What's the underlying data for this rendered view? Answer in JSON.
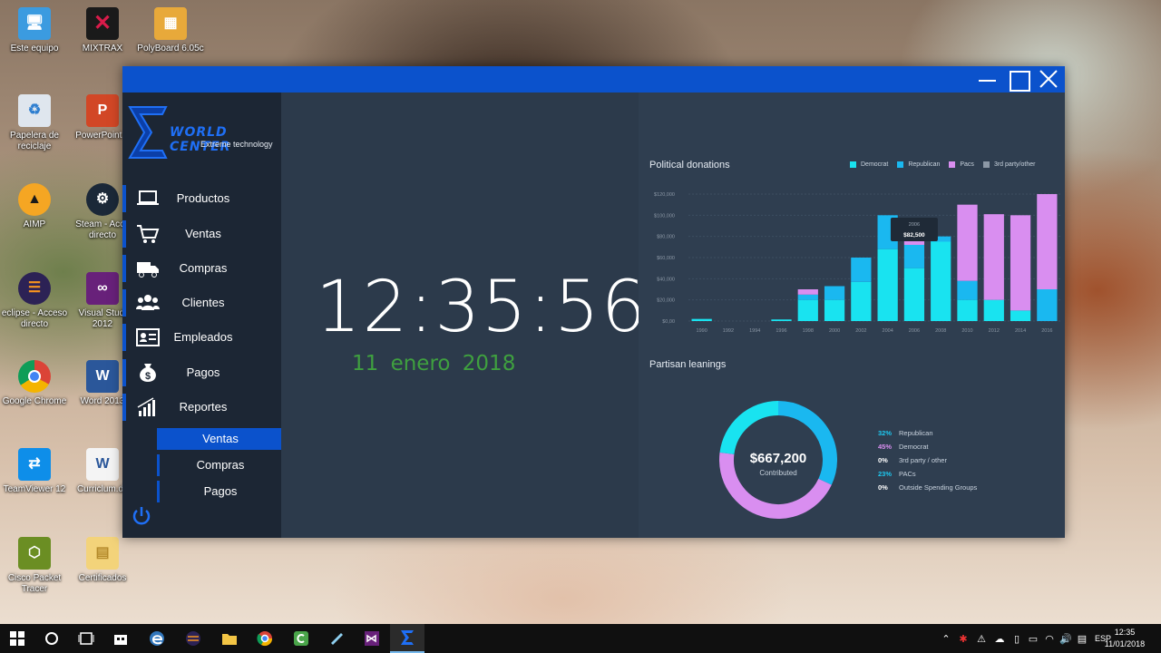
{
  "desktop": {
    "icons": [
      {
        "label": "Este equipo",
        "glyph": "this-pc-icon"
      },
      {
        "label": "MIXTRAX",
        "glyph": "mixtrax-icon"
      },
      {
        "label": "PolyBoard 6.05c",
        "glyph": "polyboard-icon"
      },
      {
        "label": "Papelera de reciclaje",
        "glyph": "recycle-bin-icon"
      },
      {
        "label": "PowerPoint 2",
        "glyph": "powerpoint-icon"
      },
      {
        "label": "AIMP",
        "glyph": "aimp-icon"
      },
      {
        "label": "Steam - Acce directo",
        "glyph": "steam-icon"
      },
      {
        "label": "eclipse - Acceso directo",
        "glyph": "eclipse-icon"
      },
      {
        "label": "Visual Studi 2012",
        "glyph": "visual-studio-icon"
      },
      {
        "label": "Google Chrome",
        "glyph": "chrome-icon"
      },
      {
        "label": "Word 2013",
        "glyph": "word-icon"
      },
      {
        "label": "TeamViewer 12",
        "glyph": "teamviewer-icon"
      },
      {
        "label": "Curriclum.dc",
        "glyph": "word-document-icon"
      },
      {
        "label": "Cisco Packet Tracer",
        "glyph": "cisco-packet-tracer-icon"
      },
      {
        "label": "Certificados",
        "glyph": "folder-icon"
      }
    ]
  },
  "app": {
    "logo": {
      "brand": "World Center",
      "tagline": "Extreme technology"
    },
    "menu": [
      {
        "label": "Productos",
        "icon": "laptop-icon"
      },
      {
        "label": "Ventas",
        "icon": "cart-icon"
      },
      {
        "label": "Compras",
        "icon": "truck-icon"
      },
      {
        "label": "Clientes",
        "icon": "users-icon"
      },
      {
        "label": "Empleados",
        "icon": "id-card-icon"
      },
      {
        "label": "Pagos",
        "icon": "money-bag-icon"
      },
      {
        "label": "Reportes",
        "icon": "bar-chart-icon"
      }
    ],
    "submenu": [
      {
        "label": "Ventas",
        "active": true
      },
      {
        "label": "Compras",
        "active": false
      },
      {
        "label": "Pagos",
        "active": false
      }
    ],
    "clock": {
      "time": "12:35:56",
      "date": "11 enero 2018"
    },
    "accent": "#0b52cc"
  },
  "dashboard": {
    "donations_title": "Political donations",
    "partisan_title": "Partisan leanings",
    "donut_value": "$667,200",
    "donut_label": "Contributed",
    "tooltip": {
      "year": "2006",
      "value": "$82,500"
    },
    "partisan": [
      {
        "pct": "32%",
        "label": "Republican",
        "color": "#1ec8f0"
      },
      {
        "pct": "45%",
        "label": "Democrat",
        "color": "#d98ef0"
      },
      {
        "pct": "0%",
        "label": "3rd party / other",
        "color": "#ffffff"
      },
      {
        "pct": "23%",
        "label": "PACs",
        "color": "#1ec8f0"
      },
      {
        "pct": "0%",
        "label": "Outside Spending Groups",
        "color": "#ffffff"
      }
    ]
  },
  "chart_data": [
    {
      "type": "bar",
      "stacked": true,
      "title": "Political donations",
      "categories": [
        "1990",
        "1992",
        "1994",
        "1996",
        "1998",
        "2000",
        "2002",
        "2004",
        "2006",
        "2008",
        "2010",
        "2012",
        "2014",
        "2016"
      ],
      "series": [
        {
          "name": "Democrat",
          "color": "#19e3f0",
          "values": [
            2000,
            0,
            0,
            1500,
            20000,
            20000,
            37000,
            68000,
            50000,
            75000,
            20000,
            20000,
            10000,
            0
          ]
        },
        {
          "name": "Republican",
          "color": "#1ab8f0",
          "values": [
            0,
            0,
            0,
            0,
            5000,
            13000,
            23000,
            32000,
            22000,
            5000,
            18000,
            0,
            0,
            30000
          ]
        },
        {
          "name": "Pacs",
          "color": "#d98ef0",
          "values": [
            0,
            0,
            0,
            0,
            5000,
            0,
            0,
            0,
            10000,
            0,
            72000,
            81000,
            90000,
            90000
          ]
        },
        {
          "name": "3rd party/other",
          "color": "#8c98a6",
          "values": [
            0,
            0,
            0,
            0,
            0,
            0,
            0,
            0,
            0,
            0,
            0,
            0,
            0,
            0
          ]
        }
      ],
      "y_ticks": [
        "$0,00",
        "$20,000",
        "$40,000",
        "$60,000",
        "$80,000",
        "$100,000",
        "$120,000"
      ],
      "ylim": [
        0,
        120000
      ],
      "legend": "top-right"
    },
    {
      "type": "pie",
      "title": "Partisan leanings",
      "categories": [
        "Republican",
        "Democrat",
        "3rd party / other",
        "PACs",
        "Outside Spending Groups"
      ],
      "values": [
        32,
        45,
        0,
        23,
        0
      ],
      "colors": [
        "#1ab8f0",
        "#d98ef0",
        "#8c98a6",
        "#19e3f0",
        "#ffffff"
      ]
    }
  ],
  "taskbar": {
    "apps": [
      "windows-start-icon",
      "cortana-icon",
      "task-view-icon",
      "store-icon",
      "edge-icon",
      "eclipse-icon",
      "file-explorer-icon",
      "chrome-icon",
      "camtasia-icon",
      "notepad-icon",
      "visual-studio-icon",
      "world-center-app-icon"
    ],
    "language": "ESP",
    "time": "12:35",
    "date": "11/01/2018"
  }
}
